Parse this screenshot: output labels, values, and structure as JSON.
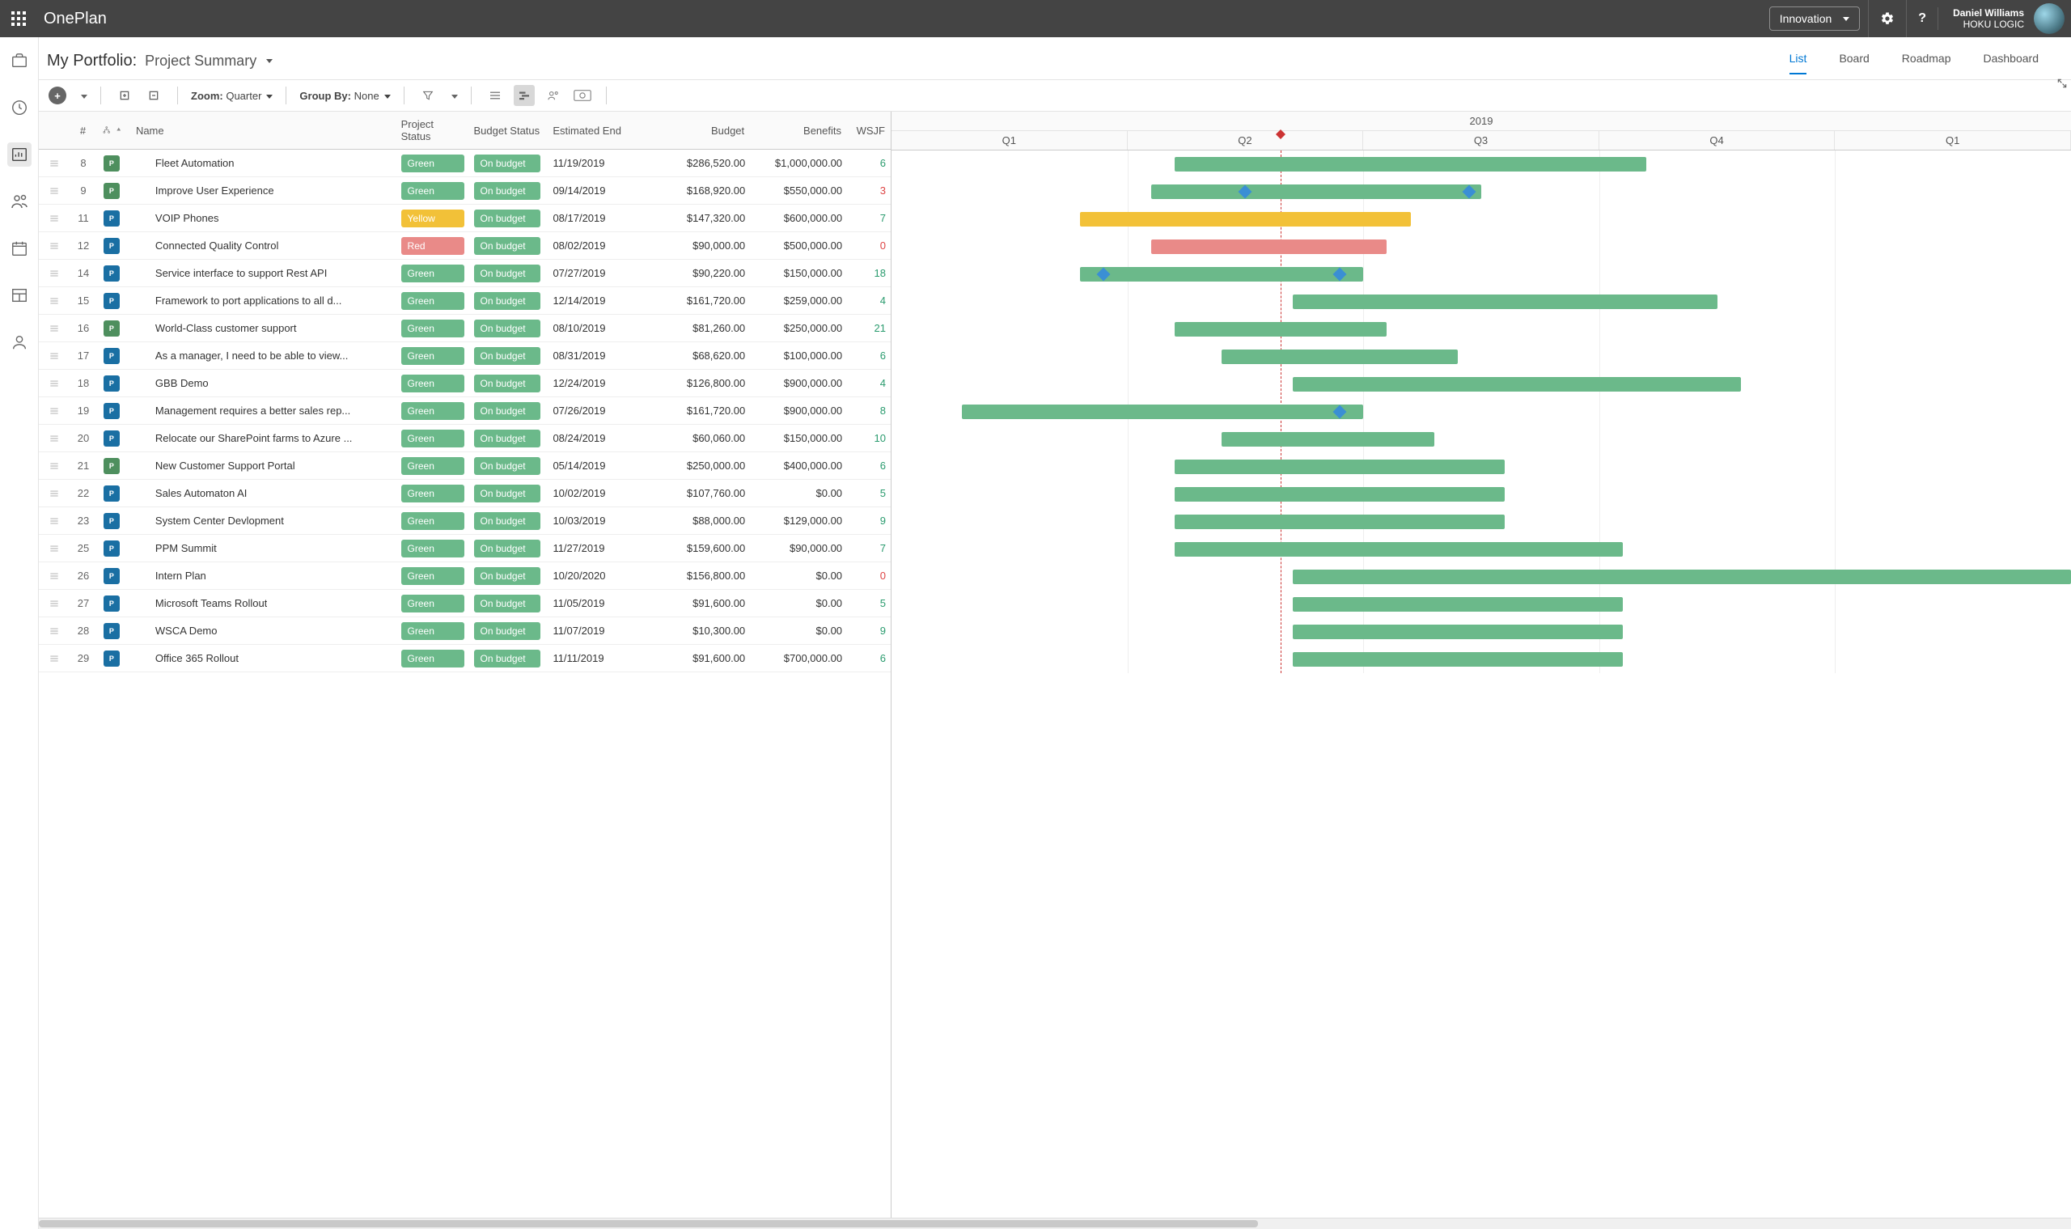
{
  "header": {
    "app_name": "OnePlan",
    "workspace": "Innovation",
    "user_name": "Daniel Williams",
    "org": "HOKU LOGIC"
  },
  "page": {
    "title": "My Portfolio:",
    "subtitle": "Project Summary",
    "tabs": [
      "List",
      "Board",
      "Roadmap",
      "Dashboard"
    ],
    "active_tab": "List"
  },
  "toolbar": {
    "zoom_label": "Zoom:",
    "zoom_value": "Quarter",
    "group_label": "Group By:",
    "group_value": "None"
  },
  "columns": {
    "num": "#",
    "name": "Name",
    "project_status": "Project Status",
    "budget_status": "Budget Status",
    "est_end": "Estimated End",
    "budget": "Budget",
    "benefits": "Benefits",
    "wsjf": "WSJF"
  },
  "gantt": {
    "year": "2019",
    "quarters": [
      "Q1",
      "Q2",
      "Q3",
      "Q4",
      "Q1"
    ]
  },
  "rows": [
    {
      "num": "8",
      "icon": "green",
      "name": "Fleet Automation",
      "ps": "Green",
      "bs": "On budget",
      "end": "11/19/2019",
      "budget": "$286,520.00",
      "benefits": "$1,000,000.00",
      "wsjf": "6",
      "wcolor": "ok",
      "bar": {
        "c": "g",
        "l": 24,
        "w": 40
      }
    },
    {
      "num": "9",
      "icon": "green",
      "name": "Improve User Experience",
      "ps": "Green",
      "bs": "On budget",
      "end": "09/14/2019",
      "budget": "$168,920.00",
      "benefits": "$550,000.00",
      "wsjf": "3",
      "wcolor": "warn",
      "bar": {
        "c": "g",
        "l": 22,
        "w": 28
      },
      "diamond": [
        30,
        49
      ]
    },
    {
      "num": "11",
      "icon": "blue",
      "name": "VOIP Phones",
      "ps": "Yellow",
      "bs": "On budget",
      "end": "08/17/2019",
      "budget": "$147,320.00",
      "benefits": "$600,000.00",
      "wsjf": "7",
      "wcolor": "ok",
      "bar": {
        "c": "y",
        "l": 16,
        "w": 28
      }
    },
    {
      "num": "12",
      "icon": "blue",
      "name": "Connected Quality Control",
      "ps": "Red",
      "bs": "On budget",
      "end": "08/02/2019",
      "budget": "$90,000.00",
      "benefits": "$500,000.00",
      "wsjf": "0",
      "wcolor": "warn",
      "bar": {
        "c": "r",
        "l": 22,
        "w": 20
      }
    },
    {
      "num": "14",
      "icon": "blue",
      "name": "Service interface to support Rest API",
      "ps": "Green",
      "bs": "On budget",
      "end": "07/27/2019",
      "budget": "$90,220.00",
      "benefits": "$150,000.00",
      "wsjf": "18",
      "wcolor": "ok",
      "bar": {
        "c": "g",
        "l": 16,
        "w": 24
      },
      "diamond": [
        18,
        38
      ]
    },
    {
      "num": "15",
      "icon": "blue",
      "name": "Framework to port applications to all d...",
      "ps": "Green",
      "bs": "On budget",
      "end": "12/14/2019",
      "budget": "$161,720.00",
      "benefits": "$259,000.00",
      "wsjf": "4",
      "wcolor": "ok",
      "bar": {
        "c": "g",
        "l": 34,
        "w": 36
      }
    },
    {
      "num": "16",
      "icon": "green",
      "name": "World-Class customer support",
      "ps": "Green",
      "bs": "On budget",
      "end": "08/10/2019",
      "budget": "$81,260.00",
      "benefits": "$250,000.00",
      "wsjf": "21",
      "wcolor": "ok",
      "bar": {
        "c": "g",
        "l": 24,
        "w": 18
      }
    },
    {
      "num": "17",
      "icon": "blue",
      "name": "As a manager, I need to be able to view...",
      "ps": "Green",
      "bs": "On budget",
      "end": "08/31/2019",
      "budget": "$68,620.00",
      "benefits": "$100,000.00",
      "wsjf": "6",
      "wcolor": "ok",
      "bar": {
        "c": "g",
        "l": 28,
        "w": 20
      }
    },
    {
      "num": "18",
      "icon": "blue",
      "name": "GBB Demo",
      "ps": "Green",
      "bs": "On budget",
      "end": "12/24/2019",
      "budget": "$126,800.00",
      "benefits": "$900,000.00",
      "wsjf": "4",
      "wcolor": "ok",
      "bar": {
        "c": "g",
        "l": 34,
        "w": 38
      }
    },
    {
      "num": "19",
      "icon": "blue",
      "name": "Management requires a better sales rep...",
      "ps": "Green",
      "bs": "On budget",
      "end": "07/26/2019",
      "budget": "$161,720.00",
      "benefits": "$900,000.00",
      "wsjf": "8",
      "wcolor": "ok",
      "bar": {
        "c": "g",
        "l": 6,
        "w": 34
      },
      "diamond": [
        38
      ]
    },
    {
      "num": "20",
      "icon": "blue",
      "name": "Relocate our SharePoint farms to Azure ...",
      "ps": "Green",
      "bs": "On budget",
      "end": "08/24/2019",
      "budget": "$60,060.00",
      "benefits": "$150,000.00",
      "wsjf": "10",
      "wcolor": "ok",
      "bar": {
        "c": "g",
        "l": 28,
        "w": 18
      }
    },
    {
      "num": "21",
      "icon": "green",
      "name": "New Customer Support Portal",
      "ps": "Green",
      "bs": "On budget",
      "end": "05/14/2019",
      "budget": "$250,000.00",
      "benefits": "$400,000.00",
      "wsjf": "6",
      "wcolor": "ok",
      "bar": {
        "c": "g",
        "l": 24,
        "w": 28
      }
    },
    {
      "num": "22",
      "icon": "blue",
      "name": "Sales Automaton AI",
      "ps": "Green",
      "bs": "On budget",
      "end": "10/02/2019",
      "budget": "$107,760.00",
      "benefits": "$0.00",
      "wsjf": "5",
      "wcolor": "ok",
      "bar": {
        "c": "g",
        "l": 24,
        "w": 28
      }
    },
    {
      "num": "23",
      "icon": "blue",
      "name": "System Center Devlopment",
      "ps": "Green",
      "bs": "On budget",
      "end": "10/03/2019",
      "budget": "$88,000.00",
      "benefits": "$129,000.00",
      "wsjf": "9",
      "wcolor": "ok",
      "bar": {
        "c": "g",
        "l": 24,
        "w": 28
      }
    },
    {
      "num": "25",
      "icon": "blue",
      "name": "PPM Summit",
      "ps": "Green",
      "bs": "On budget",
      "end": "11/27/2019",
      "budget": "$159,600.00",
      "benefits": "$90,000.00",
      "wsjf": "7",
      "wcolor": "ok",
      "bar": {
        "c": "g",
        "l": 24,
        "w": 38
      }
    },
    {
      "num": "26",
      "icon": "blue",
      "name": "Intern Plan",
      "ps": "Green",
      "bs": "On budget",
      "end": "10/20/2020",
      "budget": "$156,800.00",
      "benefits": "$0.00",
      "wsjf": "0",
      "wcolor": "warn",
      "bar": {
        "c": "g",
        "l": 34,
        "w": 66
      }
    },
    {
      "num": "27",
      "icon": "blue",
      "name": "Microsoft Teams Rollout",
      "ps": "Green",
      "bs": "On budget",
      "end": "11/05/2019",
      "budget": "$91,600.00",
      "benefits": "$0.00",
      "wsjf": "5",
      "wcolor": "ok",
      "bar": {
        "c": "g",
        "l": 34,
        "w": 28
      }
    },
    {
      "num": "28",
      "icon": "blue",
      "name": "WSCA Demo",
      "ps": "Green",
      "bs": "On budget",
      "end": "11/07/2019",
      "budget": "$10,300.00",
      "benefits": "$0.00",
      "wsjf": "9",
      "wcolor": "ok",
      "bar": {
        "c": "g",
        "l": 34,
        "w": 28
      }
    },
    {
      "num": "29",
      "icon": "blue",
      "name": "Office 365 Rollout",
      "ps": "Green",
      "bs": "On budget",
      "end": "11/11/2019",
      "budget": "$91,600.00",
      "benefits": "$700,000.00",
      "wsjf": "6",
      "wcolor": "ok",
      "bar": {
        "c": "g",
        "l": 34,
        "w": 28
      }
    }
  ]
}
